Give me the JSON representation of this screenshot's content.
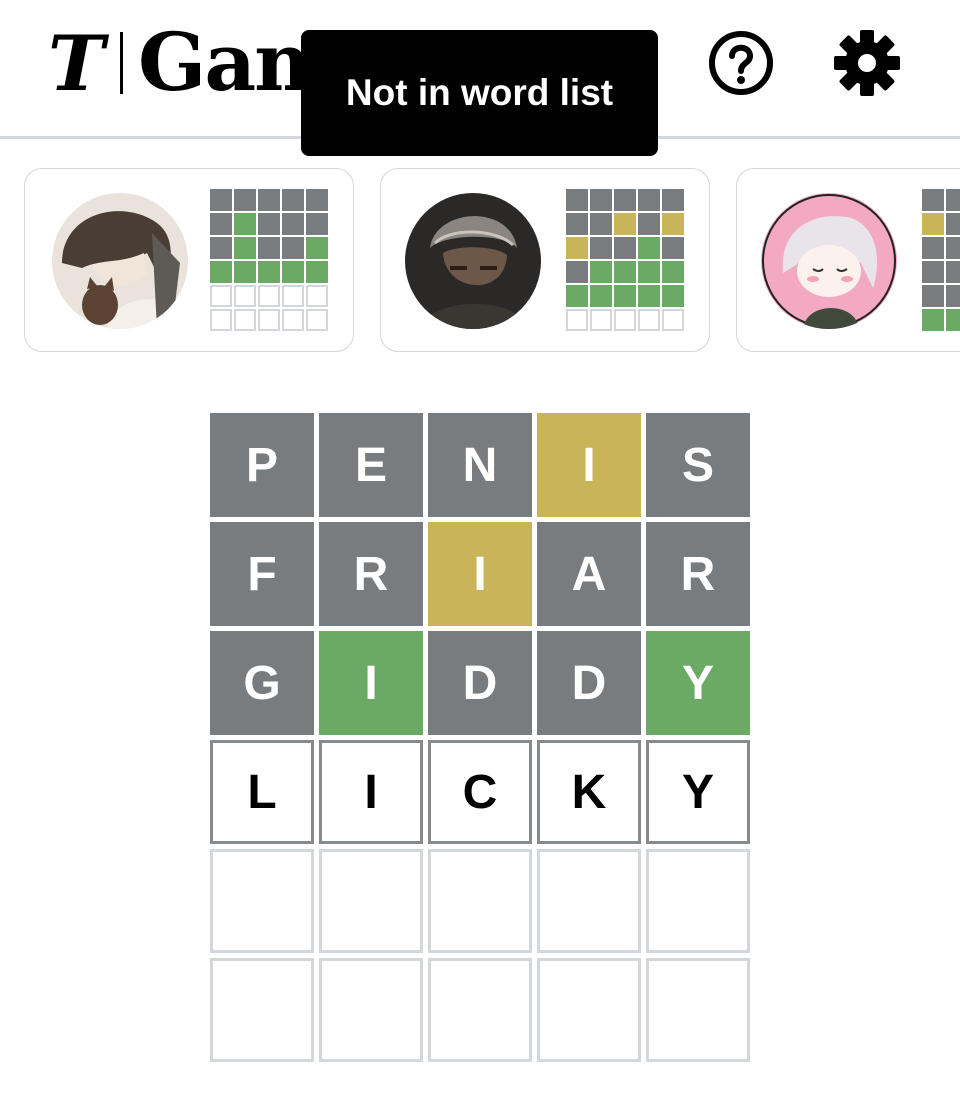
{
  "header": {
    "logo_mark": "T",
    "title": "Games",
    "help_icon": "help-circle-icon",
    "settings_icon": "gear-icon"
  },
  "toast": {
    "message": "Not in word list"
  },
  "colors": {
    "absent": "#787c7e",
    "present": "#c9b458",
    "correct": "#6aaa64",
    "border_empty": "#d3d6da",
    "border_filled": "#878a8c"
  },
  "friends": [
    {
      "avatar": "friend-avatar-anime-boy-with-cat",
      "grid": [
        [
          "absent",
          "absent",
          "absent",
          "absent",
          "absent"
        ],
        [
          "absent",
          "correct",
          "absent",
          "absent",
          "absent"
        ],
        [
          "absent",
          "correct",
          "absent",
          "absent",
          "correct"
        ],
        [
          "correct",
          "correct",
          "correct",
          "correct",
          "correct"
        ],
        [
          "empty",
          "empty",
          "empty",
          "empty",
          "empty"
        ],
        [
          "empty",
          "empty",
          "empty",
          "empty",
          "empty"
        ]
      ]
    },
    {
      "avatar": "friend-avatar-dark-warrior",
      "grid": [
        [
          "absent",
          "absent",
          "absent",
          "absent",
          "absent"
        ],
        [
          "absent",
          "absent",
          "present",
          "absent",
          "present"
        ],
        [
          "present",
          "absent",
          "absent",
          "correct",
          "absent"
        ],
        [
          "absent",
          "correct",
          "correct",
          "correct",
          "correct"
        ],
        [
          "correct",
          "correct",
          "correct",
          "correct",
          "correct"
        ],
        [
          "empty",
          "empty",
          "empty",
          "empty",
          "empty"
        ]
      ]
    },
    {
      "avatar": "friend-avatar-pink-chibi",
      "grid": [
        [
          "absent",
          "absent",
          "absent",
          "absent",
          "absent"
        ],
        [
          "present",
          "absent",
          "absent",
          "absent",
          "absent"
        ],
        [
          "absent",
          "absent",
          "absent",
          "absent",
          "absent"
        ],
        [
          "absent",
          "absent",
          "absent",
          "absent",
          "absent"
        ],
        [
          "absent",
          "absent",
          "absent",
          "absent",
          "absent"
        ],
        [
          "correct",
          "correct",
          "correct",
          "correct",
          "correct"
        ]
      ]
    }
  ],
  "board": {
    "rows": [
      {
        "letters": [
          "P",
          "E",
          "N",
          "I",
          "S"
        ],
        "states": [
          "absent",
          "absent",
          "absent",
          "present",
          "absent"
        ]
      },
      {
        "letters": [
          "F",
          "R",
          "I",
          "A",
          "R"
        ],
        "states": [
          "absent",
          "absent",
          "present",
          "absent",
          "absent"
        ]
      },
      {
        "letters": [
          "G",
          "I",
          "D",
          "D",
          "Y"
        ],
        "states": [
          "absent",
          "correct",
          "absent",
          "absent",
          "correct"
        ]
      },
      {
        "letters": [
          "L",
          "I",
          "C",
          "K",
          "Y"
        ],
        "states": [
          "tbd",
          "tbd",
          "tbd",
          "tbd",
          "tbd"
        ]
      },
      {
        "letters": [
          "",
          "",
          "",
          "",
          ""
        ],
        "states": [
          "empty",
          "empty",
          "empty",
          "empty",
          "empty"
        ]
      },
      {
        "letters": [
          "",
          "",
          "",
          "",
          ""
        ],
        "states": [
          "empty",
          "empty",
          "empty",
          "empty",
          "empty"
        ]
      }
    ]
  }
}
